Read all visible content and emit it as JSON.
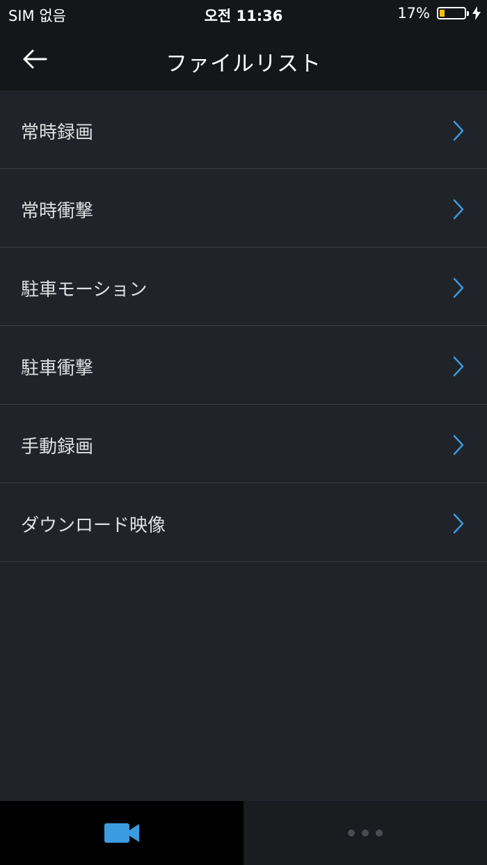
{
  "status_bar": {
    "carrier": "SIM 없음",
    "time": "오전 11:36",
    "battery_percent": "17%",
    "battery_level": 0.17,
    "charging": true,
    "battery_color": "#f2c200"
  },
  "nav": {
    "title": "ファイルリスト",
    "back_icon": "arrow-left-icon"
  },
  "list": {
    "items": [
      {
        "label": "常時録画"
      },
      {
        "label": "常時衝撃"
      },
      {
        "label": "駐車モーション"
      },
      {
        "label": "駐車衝撃"
      },
      {
        "label": "手動録画"
      },
      {
        "label": "ダウンロード映像"
      }
    ],
    "chevron_icon": "chevron-right-icon",
    "accent_color": "#3b9be0"
  },
  "tab_bar": {
    "tabs": [
      {
        "icon": "video-camera-icon",
        "active": true
      },
      {
        "icon": "more-dots-icon",
        "active": false
      }
    ]
  }
}
